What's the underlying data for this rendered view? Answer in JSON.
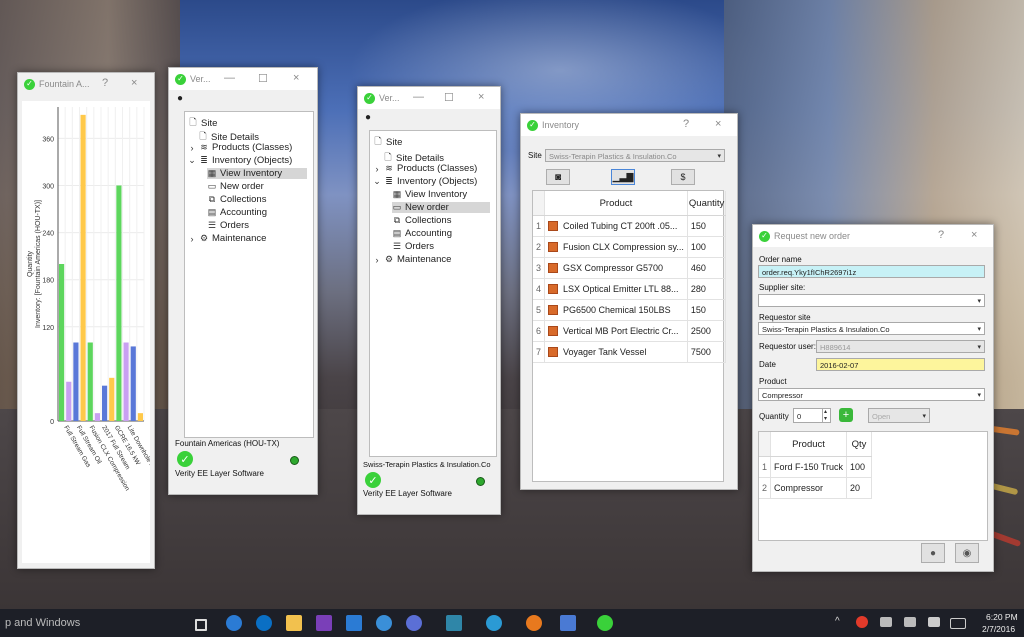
{
  "desktop": {
    "colors": {
      "accent_green": "#3ad13a",
      "taskbar": "#1d1f27",
      "window_bg": "#f0f0f0"
    }
  },
  "chart_window": {
    "title": "Fountain A...",
    "help": "?",
    "close": "×"
  },
  "chart_data": {
    "type": "bar",
    "title": "",
    "ylabel_line1": "Quantity",
    "ylabel_line2": "Inventory: [Fountain Americas (HOU-TX)]",
    "ylim": [
      0,
      400
    ],
    "yticks": [
      "0",
      "120",
      "180",
      "240",
      "300",
      "360"
    ],
    "ytick_values": [
      0,
      120,
      180,
      240,
      300,
      360
    ],
    "xtick_labels": [
      "Full Stream Gas",
      "Full Stream Oil",
      "Fusion CLX Compression",
      "2017 Full Stream",
      "GCRE 16.5 kW",
      "Lite Downhole Motor"
    ],
    "bars": [
      {
        "value": 200,
        "color": "#5dd65d"
      },
      {
        "value": 50,
        "color": "#c9a0f2"
      },
      {
        "value": 100,
        "color": "#5a78d8"
      },
      {
        "value": 390,
        "color": "#ffc94a"
      },
      {
        "value": 100,
        "color": "#5dd65d"
      },
      {
        "value": 10,
        "color": "#c9a0f2"
      },
      {
        "value": 45,
        "color": "#5a78d8"
      },
      {
        "value": 55,
        "color": "#ffc94a"
      },
      {
        "value": 300,
        "color": "#5dd65d"
      },
      {
        "value": 100,
        "color": "#c9a0f2"
      },
      {
        "value": 95,
        "color": "#5a78d8"
      },
      {
        "value": 10,
        "color": "#ffc94a"
      }
    ]
  },
  "verity1": {
    "title": "Ver...",
    "minimize": "—",
    "maximize": "☐",
    "close": "×",
    "tree": {
      "site": "Site",
      "site_details": "Site Details",
      "products": "Products (Classes)",
      "inventory": "Inventory (Objects)",
      "view_inventory": "View Inventory",
      "new_order": "New order",
      "collections": "Collections",
      "accounting": "Accounting",
      "orders": "Orders",
      "maintenance": "Maintenance"
    },
    "footer_site": "Fountain Americas (HOU-TX)",
    "footer_company": "Verity EE Layer Software"
  },
  "verity2": {
    "title": "Ver...",
    "minimize": "—",
    "maximize": "☐",
    "close": "×",
    "tree": {
      "site": "Site",
      "site_details": "Site Details",
      "products": "Products (Classes)",
      "inventory": "Inventory (Objects)",
      "view_inventory": "View Inventory",
      "new_order": "New order",
      "collections": "Collections",
      "accounting": "Accounting",
      "orders": "Orders",
      "maintenance": "Maintenance"
    },
    "footer_site": "Swiss-Terapin Plastics & Insulation.Co",
    "footer_company": "Verity EE Layer Software"
  },
  "inventory": {
    "title": "Inventory",
    "help": "?",
    "close": "×",
    "site_label": "Site",
    "site_value": "Swiss-Terapin Plastics & Insulation.Co",
    "columns": [
      "Product",
      "Quantity"
    ],
    "rows": [
      {
        "n": "1",
        "product": "Coiled Tubing CT 200ft .05...",
        "qty": "150"
      },
      {
        "n": "2",
        "product": "Fusion CLX Compression sy...",
        "qty": "100"
      },
      {
        "n": "3",
        "product": "GSX Compressor G5700",
        "qty": "460"
      },
      {
        "n": "4",
        "product": "LSX Optical Emitter LTL 88...",
        "qty": "280"
      },
      {
        "n": "5",
        "product": "PG6500 Chemical 150LBS",
        "qty": "150"
      },
      {
        "n": "6",
        "product": "Vertical MB Port Electric Cr...",
        "qty": "2500"
      },
      {
        "n": "7",
        "product": "Voyager Tank Vessel",
        "qty": "7500"
      }
    ]
  },
  "order": {
    "title": "Request new order",
    "help": "?",
    "close": "×",
    "order_name_label": "Order name",
    "order_name_value": "order.req.Yky1fIChR2697i1z",
    "supplier_label": "Supplier site:",
    "supplier_value": "",
    "requestor_site_label": "Requestor site",
    "requestor_site_value": "Swiss-Terapin Plastics & Insulation.Co",
    "requestor_user_label": "Requestor user:",
    "requestor_user_value": "H889614",
    "date_label": "Date",
    "date_value": "2016-02-07",
    "product_label": "Product",
    "product_value": "Compressor",
    "quantity_label": "Quantity",
    "quantity_value": "0",
    "status_value": "Open",
    "columns": [
      "Product",
      "Qty"
    ],
    "rows": [
      {
        "n": "1",
        "product": "Ford F-150 Truck",
        "qty": "100"
      },
      {
        "n": "2",
        "product": "Compressor",
        "qty": "20"
      }
    ]
  },
  "taskbar": {
    "search_text": "p and Windows",
    "time": "6:20 PM",
    "date": "2/7/2016"
  }
}
